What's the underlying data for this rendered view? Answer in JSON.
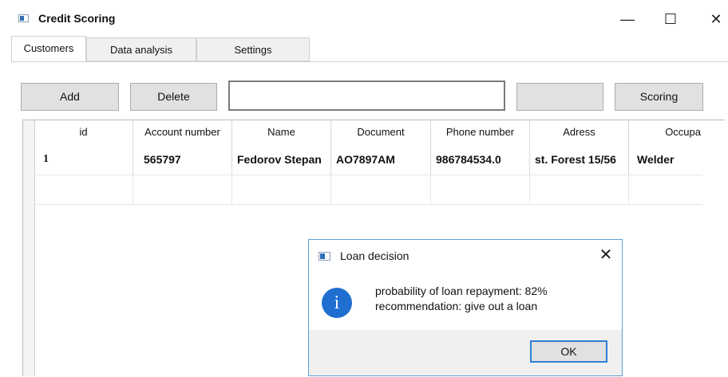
{
  "window": {
    "title": "Credit Scoring",
    "controls": {
      "minimize": "—",
      "maximize": "☐",
      "close": "✕"
    }
  },
  "tabs": [
    {
      "label": "Customers",
      "active": true
    },
    {
      "label": "Data analysis",
      "active": false
    },
    {
      "label": "Settings",
      "active": false
    }
  ],
  "toolbar": {
    "add_label": "Add",
    "delete_label": "Delete",
    "search_value": "",
    "blank_button_label": "",
    "scoring_label": "Scoring"
  },
  "grid": {
    "columns": [
      "id",
      "Account number",
      "Name",
      "Document",
      "Phone number",
      "Adress",
      "Occupa"
    ],
    "rows": [
      [
        "1",
        "565797",
        "Fedorov Stepan",
        "AO7897AM",
        "986784534.0",
        "st. Forest 15/56",
        "Welder"
      ]
    ]
  },
  "dialog": {
    "title": "Loan decision",
    "close": "✕",
    "icon": "info-icon",
    "icon_glyph": "i",
    "line1": "probability of loan repayment: 82%",
    "line2": "recommendation: give out a loan",
    "ok_label": "OK"
  },
  "colors": {
    "accent": "#2f7fd6",
    "info_icon": "#1e6fd0"
  }
}
